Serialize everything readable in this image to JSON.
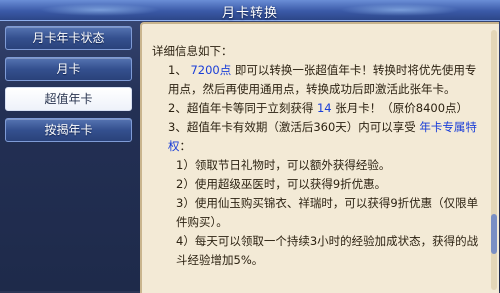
{
  "window": {
    "title": "月卡转换"
  },
  "sidebar": {
    "items": [
      {
        "label": "月卡年卡状态"
      },
      {
        "label": "月卡"
      },
      {
        "label": "超值年卡"
      },
      {
        "label": "按揭年卡"
      }
    ]
  },
  "content": {
    "heading": "详细信息如下：",
    "p1": {
      "prefix": "1、 ",
      "points": "7200点",
      "text": " 即可以转换一张超值年卡！转换时将优先使用专用点，然后再使用通用点，转换成功后即激活此张年卡。"
    },
    "p2": {
      "prefix": "2、超值年卡等同于立刻获得 ",
      "count": "14",
      "suffix": " 张月卡！（原价8400点）"
    },
    "p3": {
      "prefix": "3、超值年卡有效期（激活后360天）内可以享受 ",
      "link": "年卡专属特权",
      "suffix": "："
    },
    "items": [
      "1）领取节日礼物时，可以额外获得经验。",
      "2）使用超级巫医时，可以获得9折优惠。",
      "3）使用仙玉购买锦衣、祥瑞时，可以获得9折优惠（仅限单件购买）。",
      "4）每天可以领取一个持续3小时的经验加成状态，获得的战斗经验增加5%。"
    ]
  }
}
